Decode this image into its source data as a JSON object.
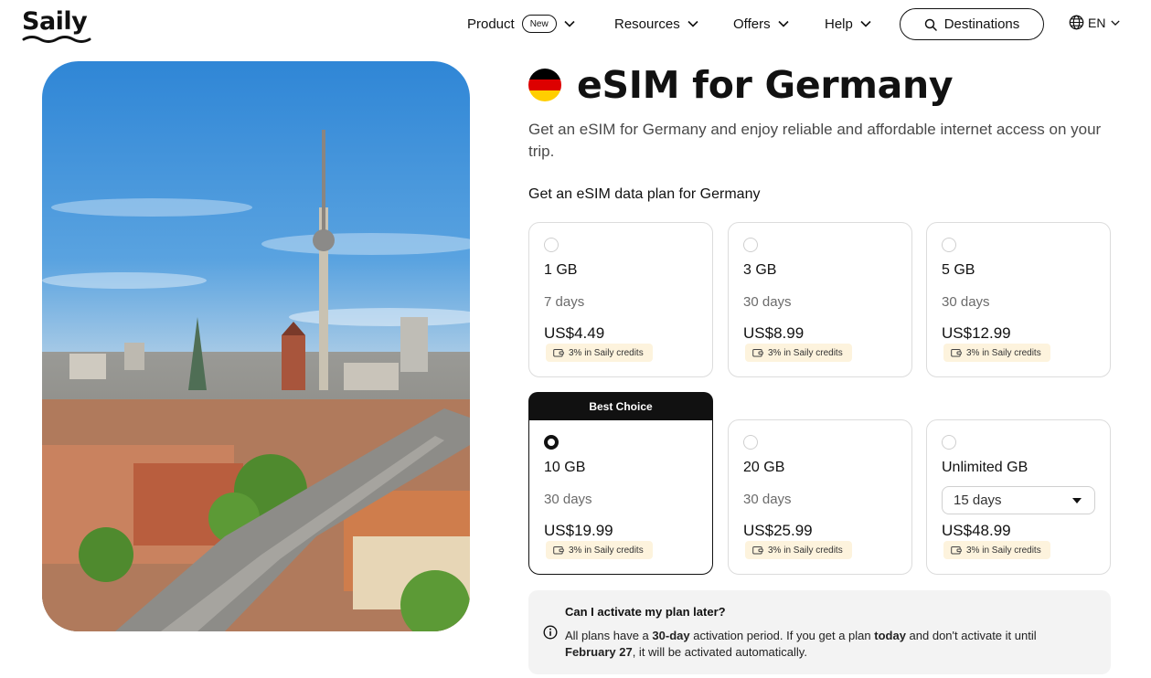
{
  "header": {
    "logo_text": "Saily",
    "nav": [
      {
        "label": "Product",
        "badge": "New"
      },
      {
        "label": "Resources"
      },
      {
        "label": "Offers"
      },
      {
        "label": "Help"
      }
    ],
    "destinations_label": "Destinations",
    "language": "EN"
  },
  "page": {
    "title": "eSIM for Germany",
    "description": "Get an eSIM for Germany and enjoy reliable and affordable internet access on your trip.",
    "plans_heading": "Get an eSIM data plan for Germany"
  },
  "plans": [
    {
      "data": "1 GB",
      "days": "7 days",
      "price": "US$4.49",
      "credits": "3% in Saily credits",
      "selected": false
    },
    {
      "data": "3 GB",
      "days": "30 days",
      "price": "US$8.99",
      "credits": "3% in Saily credits",
      "selected": false
    },
    {
      "data": "5 GB",
      "days": "30 days",
      "price": "US$12.99",
      "credits": "3% in Saily credits",
      "selected": false
    },
    {
      "data": "10 GB",
      "days": "30 days",
      "price": "US$19.99",
      "credits": "3% in Saily credits",
      "selected": true,
      "badge": "Best Choice"
    },
    {
      "data": "20 GB",
      "days": "30 days",
      "price": "US$25.99",
      "credits": "3% in Saily credits",
      "selected": false
    },
    {
      "data": "Unlimited GB",
      "days": "15 days",
      "price": "US$48.99",
      "credits": "3% in Saily credits",
      "selected": false,
      "days_is_select": true
    }
  ],
  "info": {
    "question": "Can I activate my plan later?",
    "answer_parts": [
      "All plans have a ",
      "30-day",
      " activation period. If you get a plan ",
      "today",
      " and don't activate it until ",
      "February 27",
      ", it will be activated automatically."
    ]
  },
  "colors": {
    "text": "#111111",
    "muted": "#6b6b6b",
    "credits_bg": "#fdf3dd",
    "info_bg": "#f3f3f3",
    "flag": [
      "#000000",
      "#dd0000",
      "#ffce00"
    ]
  },
  "icons": [
    "chevron-down-icon",
    "search-icon",
    "globe-icon",
    "wallet-icon",
    "info-icon",
    "dropdown-caret-icon"
  ]
}
